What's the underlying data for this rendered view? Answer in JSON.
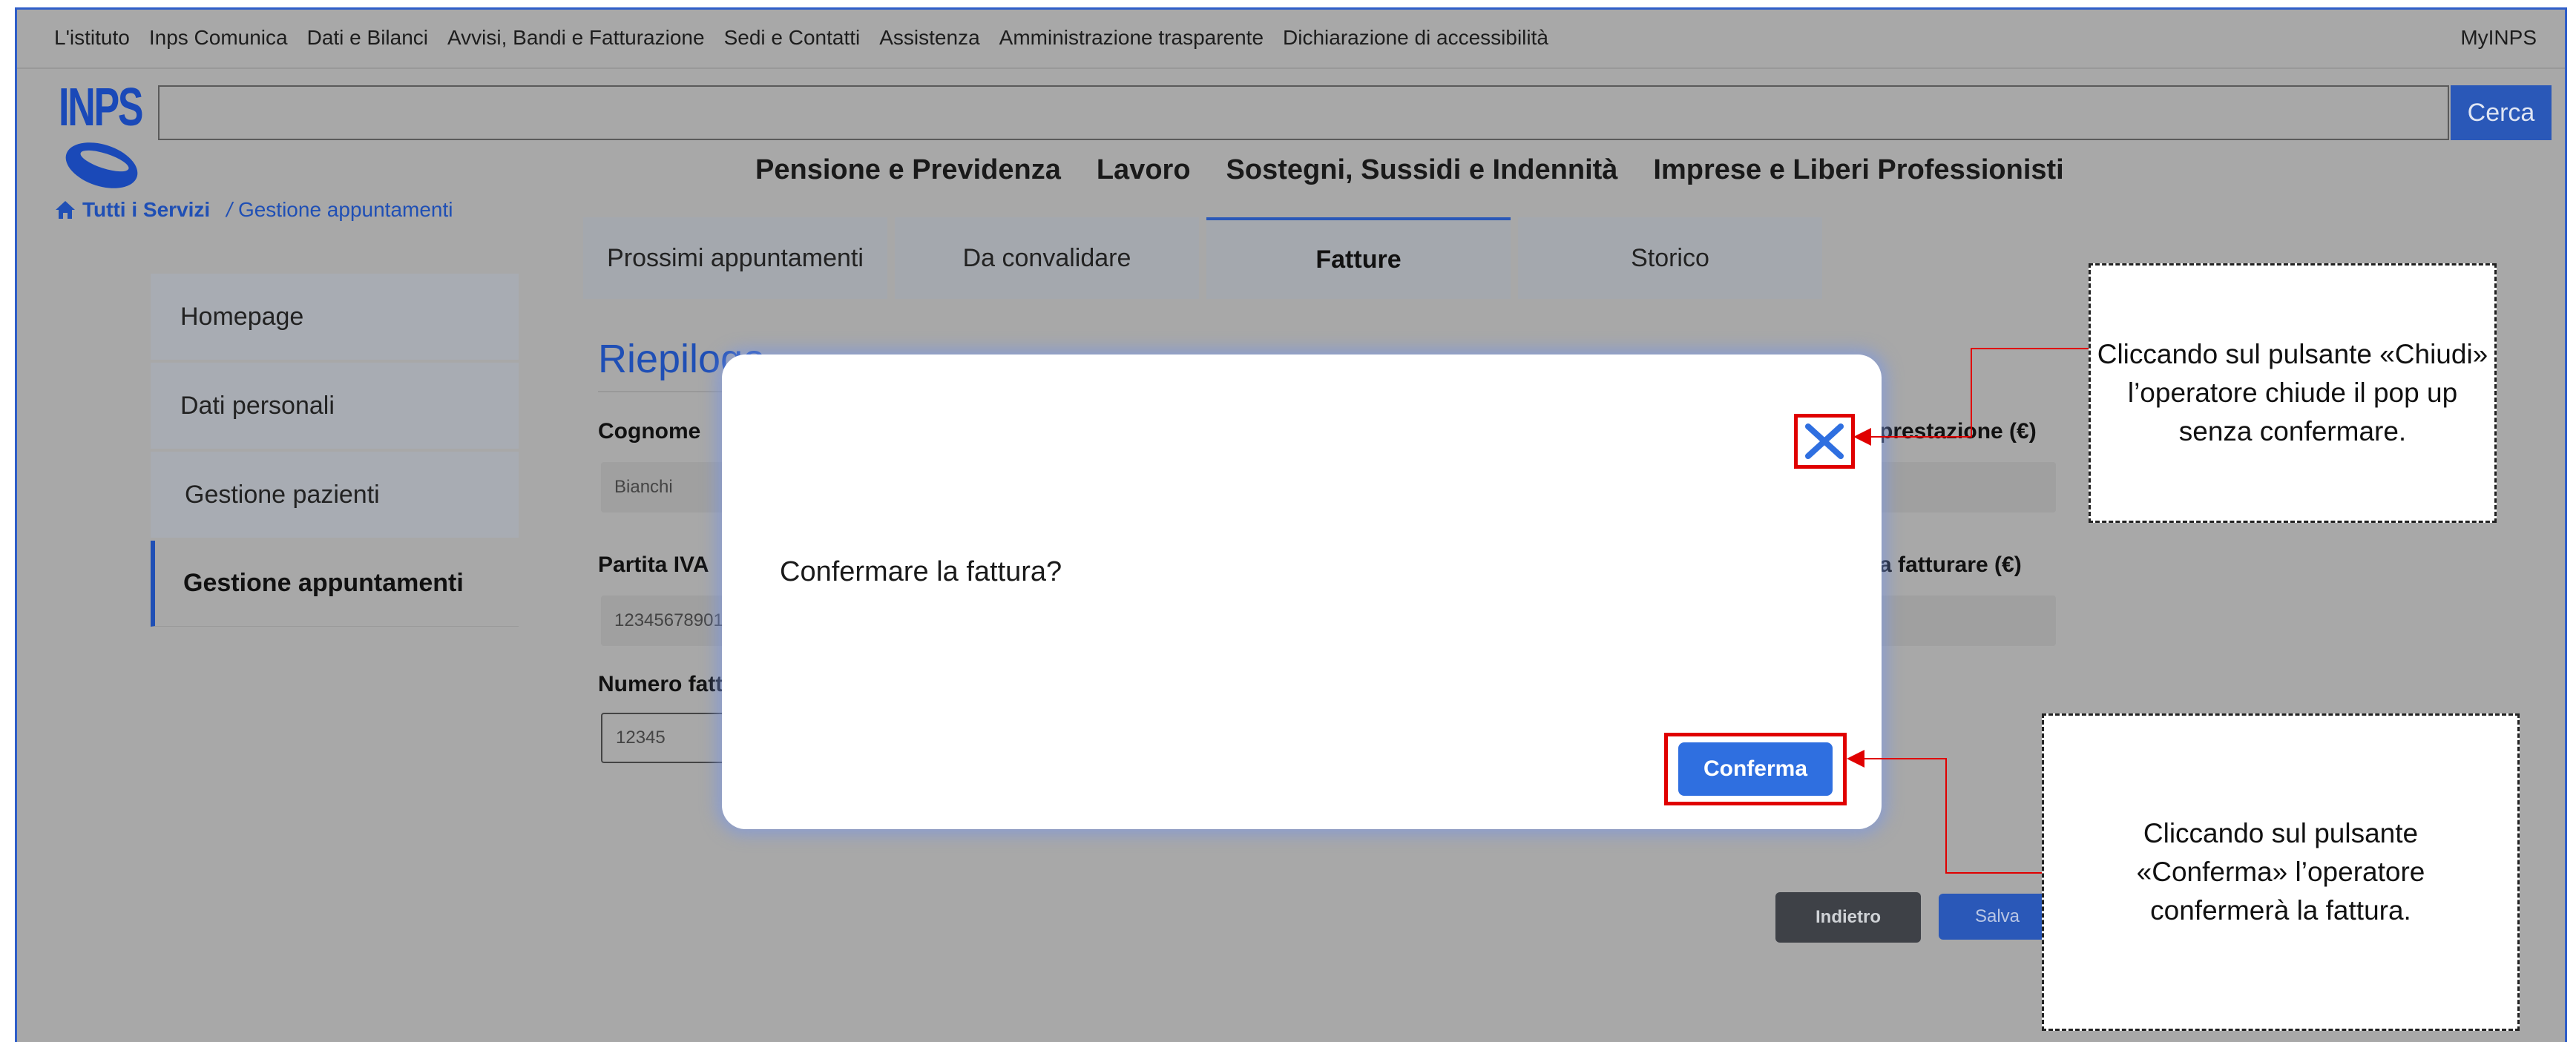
{
  "topnav": {
    "links": [
      "L'istituto",
      "Inps Comunica",
      "Dati e Bilanci",
      "Avvisi, Bandi e Fatturazione",
      "Sedi e Contatti",
      "Assistenza",
      "Amministrazione trasparente",
      "Dichiarazione di accessibilità"
    ],
    "myinps": "MyINPS"
  },
  "logo": {
    "text": "INPS"
  },
  "search": {
    "placeholder": "",
    "button_label": "Cerca"
  },
  "mainnav": [
    "Pensione e Previdenza",
    "Lavoro",
    "Sostegni, Sussidi e Indennità",
    "Imprese e Liberi Professionisti"
  ],
  "breadcrumb": {
    "home": "Tutti i Servizi",
    "separator": "/",
    "current": "Gestione appuntamenti"
  },
  "sidebar": {
    "items": [
      "Homepage",
      "Dati personali",
      "Gestione pazienti",
      "Gestione appuntamenti"
    ],
    "active_index": 3
  },
  "tabs": {
    "items": [
      "Prossimi appuntamenti",
      "Da convalidare",
      "Fatture",
      "Storico"
    ],
    "active_index": 2
  },
  "form": {
    "title": "Riepilogo",
    "cognome_label": "Cognome",
    "cognome_value": "Bianchi",
    "partita_iva_label": "Partita IVA",
    "partita_iva_value": "12345678901",
    "numero_fattura_label": "Numero fatt",
    "numero_fattura_value": "12345",
    "prestazione_label": "prestazione (€)",
    "fatturare_label": "a fatturare (€)",
    "indietro_label": "Indietro",
    "salva_label": "Salva"
  },
  "modal": {
    "message": "Confermare la fattura?",
    "close_glyph": "✕",
    "confirm_label": "Conferma"
  },
  "callouts": {
    "close": "Cliccando sul pulsante «Chiudi» l’operatore chiude il pop up senza confermare.",
    "confirm": "Cliccando sul pulsante «Conferma» l’operatore confermerà la fattura."
  },
  "colors": {
    "brand_blue": "#2a58b8",
    "confirm_blue": "#2f6fe0",
    "highlight_red": "#e00000",
    "overlay_gray": "#a8a8a8"
  }
}
